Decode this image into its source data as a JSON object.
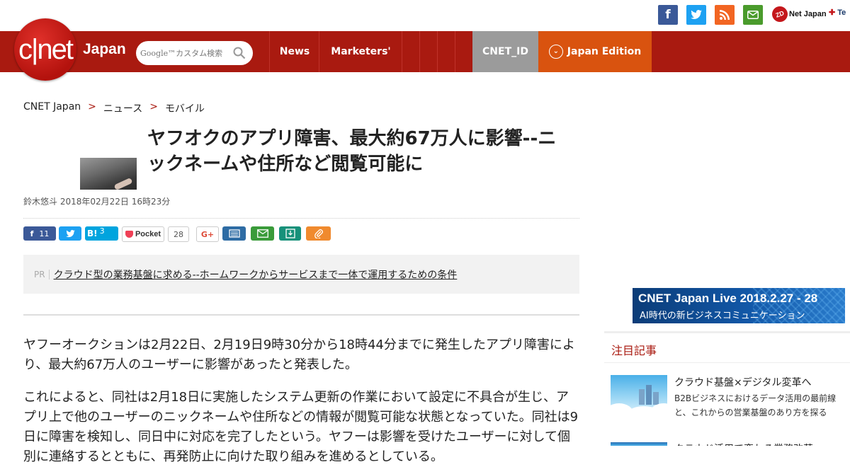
{
  "header": {
    "social": [
      {
        "name": "facebook",
        "glyph": "f",
        "color": "#3b5998"
      },
      {
        "name": "twitter",
        "glyph": "t",
        "color": "#1da1f2"
      },
      {
        "name": "rss",
        "glyph": "◉",
        "color": "#f26522"
      },
      {
        "name": "mail",
        "glyph": "✉",
        "color": "#4a9b2c"
      }
    ],
    "zdnet_label": "Net Japan",
    "zd_mark": "ZD",
    "techrepublic_label": "Te",
    "logo_text": "c|net",
    "logo_sub": "Japan",
    "search_placeholder": "Google™カスタム検索",
    "nav": {
      "news": "News",
      "marketers": "Marketers'",
      "cnet_id": "CNET_ID",
      "edition": "Japan Edition"
    }
  },
  "breadcrumb": {
    "home": "CNET Japan",
    "sep": ">",
    "level1": "ニュース",
    "level2": "モバイル"
  },
  "article": {
    "title": "ヤフオクのアプリ障害、最大約67万人に影響--ニックネームや住所など閲覧可能に",
    "date": "鈴木悠斗 2018年02月22日 16時23分",
    "share": {
      "facebook_count": "11",
      "hatena_count": "3",
      "pocket_label": "Pocket",
      "pocket_count": "28",
      "gplus_label": "G+"
    },
    "pr_label": "PR",
    "pr_text": "クラウド型の業務基盤に求める--ホームワークからサービスまで一体で運用するための条件",
    "paragraph1": "ヤフーオークションは2月22日、2月19日9時30分から18時44分までに発生したアプリ障害により、最大約67万人のユーザーに影響があったと発表した。",
    "paragraph2": "これによると、同社は2月18日に実施したシステム更新の作業において設定に不具合が生じ、アプリ上で他のユーザーのニックネームや住所などの情報が閲覧可能な状態となっていた。同社は9日に障害を検知し、同日中に対応を完了したという。ヤフーは影響を受けたユーザーに対して個別に連絡するとともに、再発防止に向けた取り組みを進めるとしている。"
  },
  "sidebar": {
    "banner_line1": "CNET Japan Live 2018.2.27 - 28",
    "banner_line2": "AI時代の新ビジネスコミュニケーション",
    "section_title": "注目記事",
    "item1_title": "クラウド基盤×デジタル変革へ",
    "item1_desc": "B2Bビジネスにおけるデータ活用の最前線と、これからの営業基盤のあり方を探る",
    "item2_title": "クラウド活用で変わる業務改革"
  }
}
